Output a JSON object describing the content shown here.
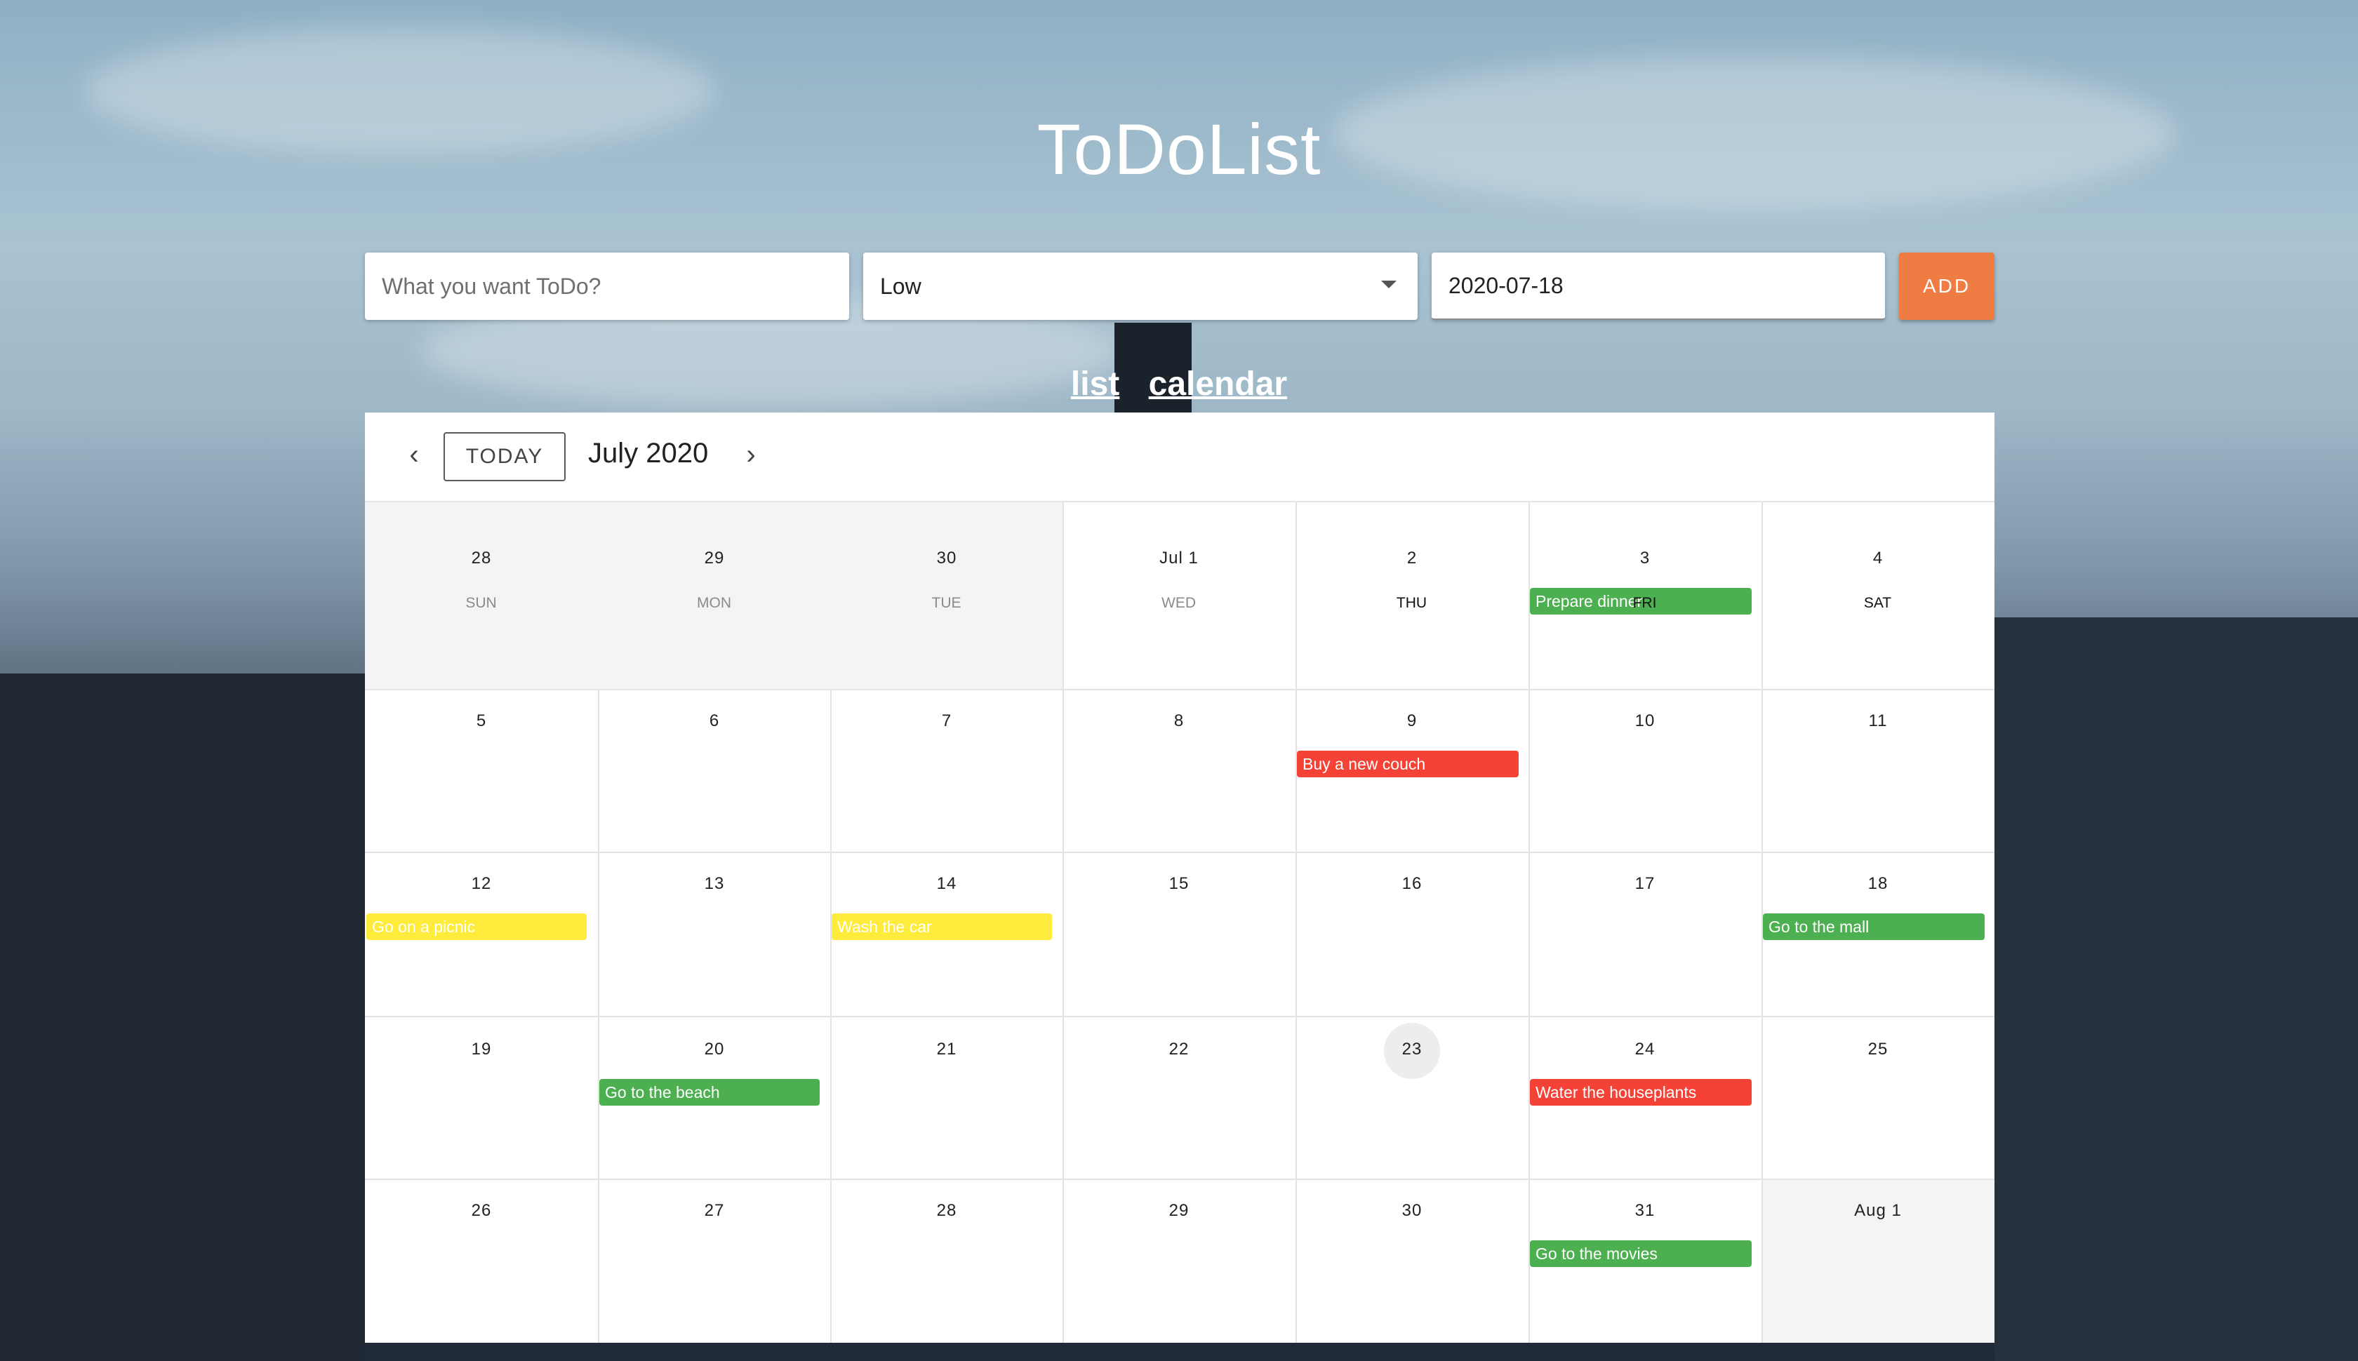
{
  "app": {
    "title": "ToDoList"
  },
  "form": {
    "task_placeholder": "What you want ToDo?",
    "task_value": "",
    "priority_value": "Low",
    "date_value": "2020-07-18",
    "add_label": "ADD"
  },
  "views": {
    "list_label": "list",
    "calendar_label": "calendar"
  },
  "calendar": {
    "today_label": "TODAY",
    "month_label": "July 2020",
    "prev_icon": "chevron-left-icon",
    "next_icon": "chevron-right-icon",
    "weekdays": [
      "SUN",
      "MON",
      "TUE",
      "WED",
      "THU",
      "FRI",
      "SAT"
    ],
    "weeks": [
      [
        "28",
        "29",
        "30",
        "Jul 1",
        "2",
        "3",
        "4"
      ],
      [
        "5",
        "6",
        "7",
        "8",
        "9",
        "10",
        "11"
      ],
      [
        "12",
        "13",
        "14",
        "15",
        "16",
        "17",
        "18"
      ],
      [
        "19",
        "20",
        "21",
        "22",
        "23",
        "24",
        "25"
      ],
      [
        "26",
        "27",
        "28",
        "29",
        "30",
        "31",
        "Aug 1"
      ]
    ],
    "highlighted_day": "23",
    "events": [
      {
        "title": "Prepare dinner",
        "color": "#4caf50"
      },
      {
        "title": "Buy a new couch",
        "color": "#f44336"
      },
      {
        "title": "Go on a picnic",
        "color": "#ffeb3b"
      },
      {
        "title": "Wash the car",
        "color": "#ffeb3b"
      },
      {
        "title": "Go to the mall",
        "color": "#4caf50"
      },
      {
        "title": "Go to the beach",
        "color": "#4caf50"
      },
      {
        "title": "Water the houseplants",
        "color": "#f44336"
      },
      {
        "title": "Go to the movies",
        "color": "#4caf50"
      }
    ]
  },
  "colors": {
    "accent": "#ee7c43",
    "high": "#f44336",
    "medium": "#ffeb3b",
    "low": "#4caf50"
  }
}
